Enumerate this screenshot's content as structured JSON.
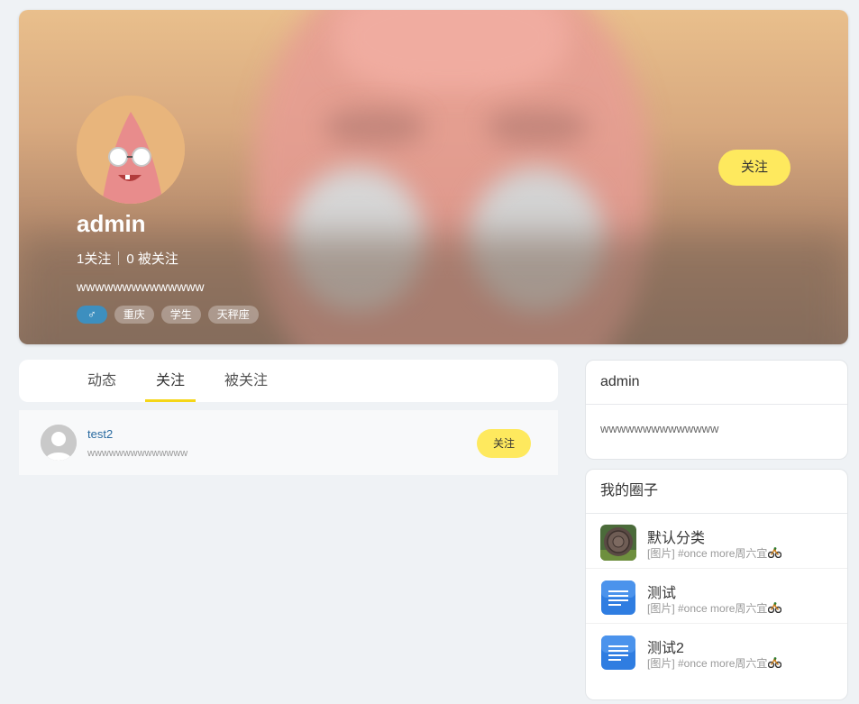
{
  "profile": {
    "username": "admin",
    "following": "1关注",
    "followers": "0 被关注",
    "bio": "wwwwwwwwwwwwww",
    "tags": {
      "gender": "♂",
      "city": "重庆",
      "job": "学生",
      "zodiac": "天秤座"
    },
    "follow_button": "关注"
  },
  "tabs": [
    "动态",
    "关注",
    "被关注"
  ],
  "active_tab": "关注",
  "follow_list": [
    {
      "name": "test2",
      "bio": "wwwwwwwwwwwwww",
      "button": "关注"
    }
  ],
  "side_profile": {
    "title": "admin",
    "bio": "wwwwwwwwwwwwww"
  },
  "circles": {
    "title": "我的圈子",
    "items": [
      {
        "name": "默认分类",
        "latest": "[图片] #once more周六宜",
        "icon": "coin-image-icon"
      },
      {
        "name": "测试",
        "latest": "[图片] #once more周六宜",
        "icon": "document-icon"
      },
      {
        "name": "测试2",
        "latest": "[图片] #once more周六宜",
        "icon": "document-icon"
      }
    ]
  },
  "colors": {
    "accent_yellow": "#fee95e",
    "tab_indicator": "#f5d617",
    "gender_tag": "#3d8fbf",
    "link_blue": "#2a6ba0"
  }
}
